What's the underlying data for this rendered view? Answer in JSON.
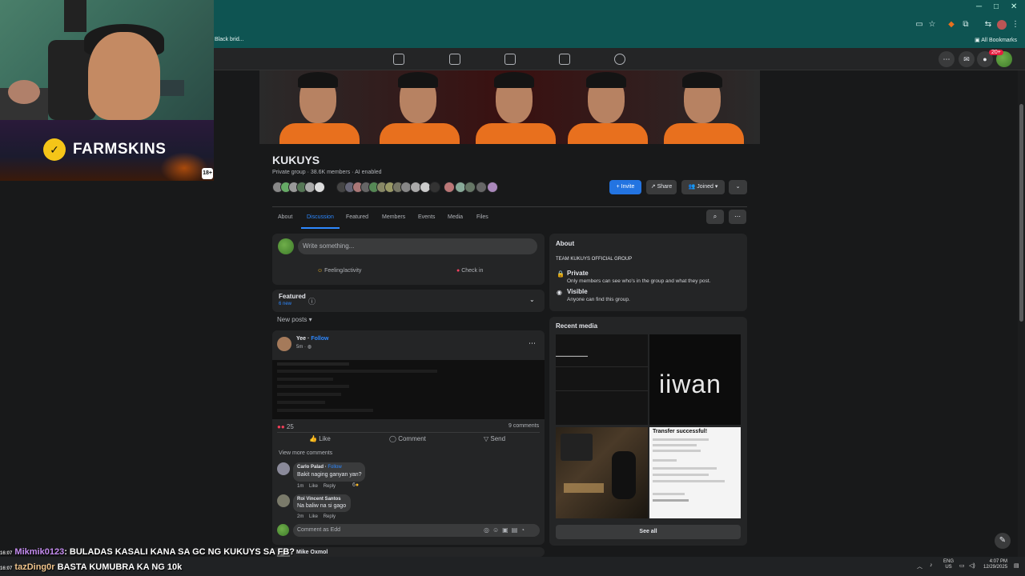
{
  "browser": {
    "bookmark_left": "Black brid...",
    "bookmark_right": "All Bookmarks"
  },
  "fb_nav": {
    "notif_count": "20+",
    "icons": [
      "home-icon",
      "video-icon",
      "marketplace-icon",
      "store-icon",
      "gaming-icon"
    ]
  },
  "stream_overlay": {
    "brand": "FARMSKINS",
    "age_badge": "18+"
  },
  "group": {
    "name": "KUKUYS",
    "meta": "Private group · 38.6K members · AI enabled",
    "invite_label": "+ Invite",
    "share_label": "Share",
    "joined_label": "Joined"
  },
  "tabs": [
    "About",
    "Discussion",
    "Featured",
    "Members",
    "Events",
    "Media",
    "Files"
  ],
  "composer": {
    "placeholder": "Write something...",
    "feeling": "Feeling/activity",
    "checkin": "Check in"
  },
  "featured": {
    "title": "Featured",
    "new_count": "6 new"
  },
  "feed": {
    "sort_label": "New posts"
  },
  "post": {
    "author": "Yee",
    "follow": "Follow",
    "time": "5m",
    "reaction_count": "25",
    "comment_count": "9 comments",
    "like": "Like",
    "comment": "Comment",
    "send": "Send",
    "view_more": "View more comments",
    "comments": [
      {
        "author": "Carlo Palad",
        "follow": "Follow",
        "text": "Bakit naging ganyan yan?",
        "time": "1m",
        "like": "Like",
        "reply": "Reply",
        "reacts": "6"
      },
      {
        "author": "Roi Vincent Santos",
        "text": "Na baliw na si gago",
        "time": "2m",
        "like": "Like",
        "reply": "Reply"
      }
    ],
    "comment_placeholder": "Comment as Edd"
  },
  "next_post_author": "Mike Oxmol",
  "about": {
    "title": "About",
    "description": "TEAM KUKUYS OFFICIAL GROUP",
    "private_title": "Private",
    "private_desc": "Only members can see who's in the group and what they post.",
    "visible_title": "Visible",
    "visible_desc": "Anyone can find this group."
  },
  "recent_media": {
    "title": "Recent media",
    "media2_text": "iiwan",
    "media4_title": "Transfer successful!",
    "see_all": "See all"
  },
  "stream_chat": [
    {
      "time": "16:07",
      "user": "Mikmik0123",
      "message": ": BULADAS KASALI KANA SA GC NG KUKUYS SA FB?"
    },
    {
      "time": "16:07",
      "user": "tazDing0r",
      "message": " BASTA KUMUBRA KA NG 10k"
    }
  ],
  "taskbar": {
    "lang": "ENG",
    "region": "US",
    "time": "4:07 PM",
    "date": "12/29/2025"
  },
  "colors": {
    "accent": "#2d88ff",
    "chrome": "#0e5452",
    "background": "#18191a",
    "card": "#242526"
  }
}
